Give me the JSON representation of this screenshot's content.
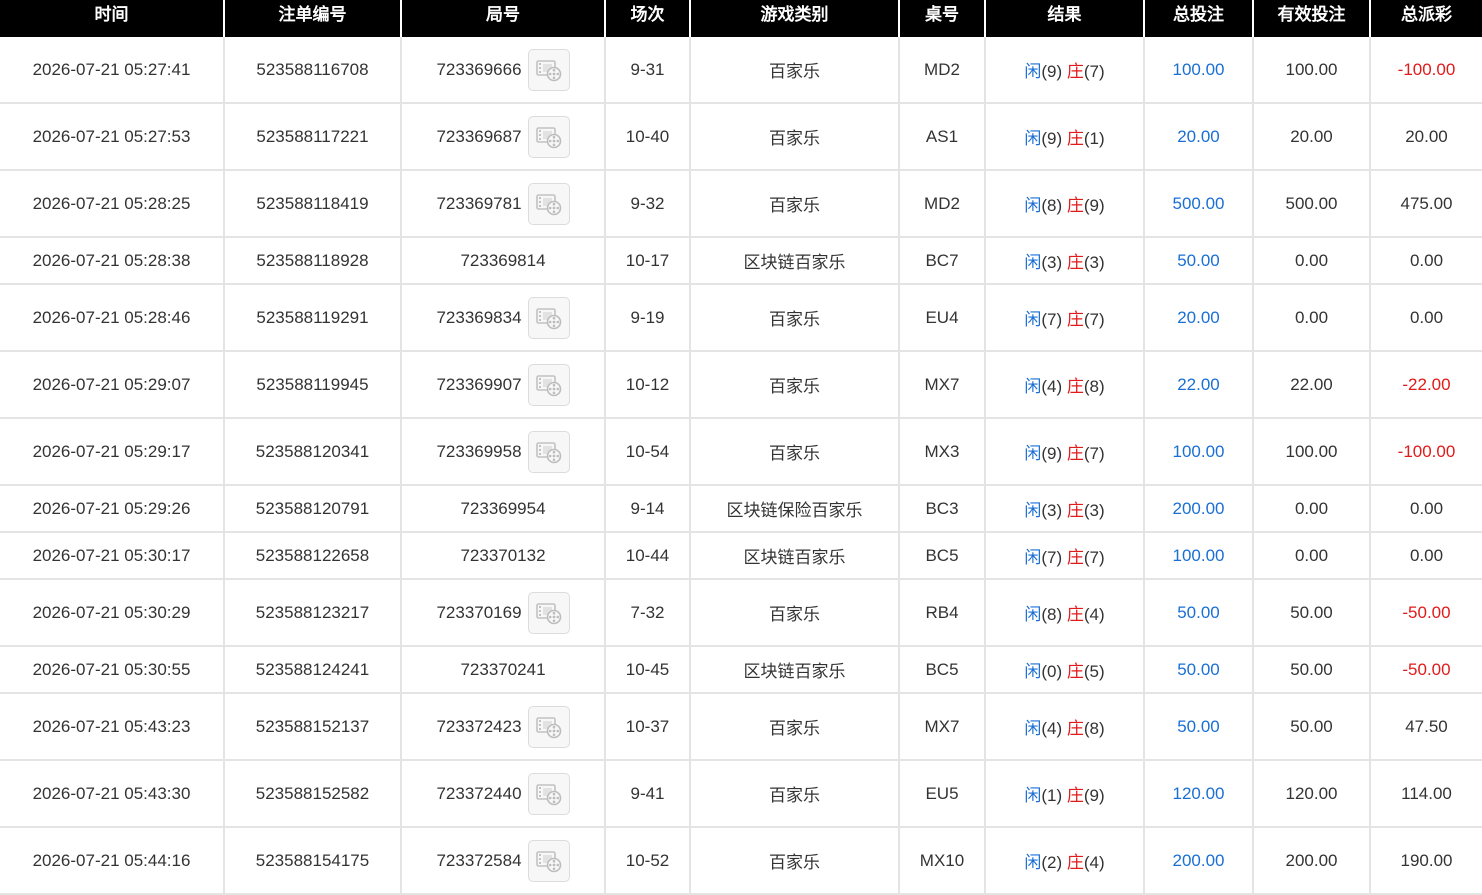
{
  "columns": [
    "时间",
    "注单编号",
    "局号",
    "场次",
    "游戏类别",
    "桌号",
    "结果",
    "总投注",
    "有效投注",
    "总派彩"
  ],
  "result_labels": {
    "player": "闲",
    "banker": "庄"
  },
  "colors": {
    "header_bg": "#000000",
    "player": "#1a6fd4",
    "banker": "#e11a1a",
    "negative": "#e11a1a",
    "bet": "#1a6fd4"
  },
  "rows": [
    {
      "time": "2026-07-21 05:27:41",
      "order_no": "523588116708",
      "round_no": "723369666",
      "has_replay": true,
      "session": "9-31",
      "game": "百家乐",
      "table": "MD2",
      "player": "(9)",
      "banker": "(7)",
      "total_bet": "100.00",
      "valid_bet": "100.00",
      "payout": "-100.00",
      "payout_negative": true
    },
    {
      "time": "2026-07-21 05:27:53",
      "order_no": "523588117221",
      "round_no": "723369687",
      "has_replay": true,
      "session": "10-40",
      "game": "百家乐",
      "table": "AS1",
      "player": "(9)",
      "banker": "(1)",
      "total_bet": "20.00",
      "valid_bet": "20.00",
      "payout": "20.00",
      "payout_negative": false
    },
    {
      "time": "2026-07-21 05:28:25",
      "order_no": "523588118419",
      "round_no": "723369781",
      "has_replay": true,
      "session": "9-32",
      "game": "百家乐",
      "table": "MD2",
      "player": "(8)",
      "banker": "(9)",
      "total_bet": "500.00",
      "valid_bet": "500.00",
      "payout": "475.00",
      "payout_negative": false
    },
    {
      "time": "2026-07-21 05:28:38",
      "order_no": "523588118928",
      "round_no": "723369814",
      "has_replay": false,
      "session": "10-17",
      "game": "区块链百家乐",
      "table": "BC7",
      "player": "(3)",
      "banker": "(3)",
      "total_bet": "50.00",
      "valid_bet": "0.00",
      "payout": "0.00",
      "payout_negative": false
    },
    {
      "time": "2026-07-21 05:28:46",
      "order_no": "523588119291",
      "round_no": "723369834",
      "has_replay": true,
      "session": "9-19",
      "game": "百家乐",
      "table": "EU4",
      "player": "(7)",
      "banker": "(7)",
      "total_bet": "20.00",
      "valid_bet": "0.00",
      "payout": "0.00",
      "payout_negative": false
    },
    {
      "time": "2026-07-21 05:29:07",
      "order_no": "523588119945",
      "round_no": "723369907",
      "has_replay": true,
      "session": "10-12",
      "game": "百家乐",
      "table": "MX7",
      "player": "(4)",
      "banker": "(8)",
      "total_bet": "22.00",
      "valid_bet": "22.00",
      "payout": "-22.00",
      "payout_negative": true
    },
    {
      "time": "2026-07-21 05:29:17",
      "order_no": "523588120341",
      "round_no": "723369958",
      "has_replay": true,
      "session": "10-54",
      "game": "百家乐",
      "table": "MX3",
      "player": "(9)",
      "banker": "(7)",
      "total_bet": "100.00",
      "valid_bet": "100.00",
      "payout": "-100.00",
      "payout_negative": true
    },
    {
      "time": "2026-07-21 05:29:26",
      "order_no": "523588120791",
      "round_no": "723369954",
      "has_replay": false,
      "session": "9-14",
      "game": "区块链保险百家乐",
      "table": "BC3",
      "player": "(3)",
      "banker": "(3)",
      "total_bet": "200.00",
      "valid_bet": "0.00",
      "payout": "0.00",
      "payout_negative": false
    },
    {
      "time": "2026-07-21 05:30:17",
      "order_no": "523588122658",
      "round_no": "723370132",
      "has_replay": false,
      "session": "10-44",
      "game": "区块链百家乐",
      "table": "BC5",
      "player": "(7)",
      "banker": "(7)",
      "total_bet": "100.00",
      "valid_bet": "0.00",
      "payout": "0.00",
      "payout_negative": false
    },
    {
      "time": "2026-07-21 05:30:29",
      "order_no": "523588123217",
      "round_no": "723370169",
      "has_replay": true,
      "session": "7-32",
      "game": "百家乐",
      "table": "RB4",
      "player": "(8)",
      "banker": "(4)",
      "total_bet": "50.00",
      "valid_bet": "50.00",
      "payout": "-50.00",
      "payout_negative": true
    },
    {
      "time": "2026-07-21 05:30:55",
      "order_no": "523588124241",
      "round_no": "723370241",
      "has_replay": false,
      "session": "10-45",
      "game": "区块链百家乐",
      "table": "BC5",
      "player": "(0)",
      "banker": "(5)",
      "total_bet": "50.00",
      "valid_bet": "50.00",
      "payout": "-50.00",
      "payout_negative": true
    },
    {
      "time": "2026-07-21 05:43:23",
      "order_no": "523588152137",
      "round_no": "723372423",
      "has_replay": true,
      "session": "10-37",
      "game": "百家乐",
      "table": "MX7",
      "player": "(4)",
      "banker": "(8)",
      "total_bet": "50.00",
      "valid_bet": "50.00",
      "payout": "47.50",
      "payout_negative": false
    },
    {
      "time": "2026-07-21 05:43:30",
      "order_no": "523588152582",
      "round_no": "723372440",
      "has_replay": true,
      "session": "9-41",
      "game": "百家乐",
      "table": "EU5",
      "player": "(1)",
      "banker": "(9)",
      "total_bet": "120.00",
      "valid_bet": "120.00",
      "payout": "114.00",
      "payout_negative": false
    },
    {
      "time": "2026-07-21 05:44:16",
      "order_no": "523588154175",
      "round_no": "723372584",
      "has_replay": true,
      "session": "10-52",
      "game": "百家乐",
      "table": "MX10",
      "player": "(2)",
      "banker": "(4)",
      "total_bet": "200.00",
      "valid_bet": "200.00",
      "payout": "190.00",
      "payout_negative": false
    }
  ]
}
